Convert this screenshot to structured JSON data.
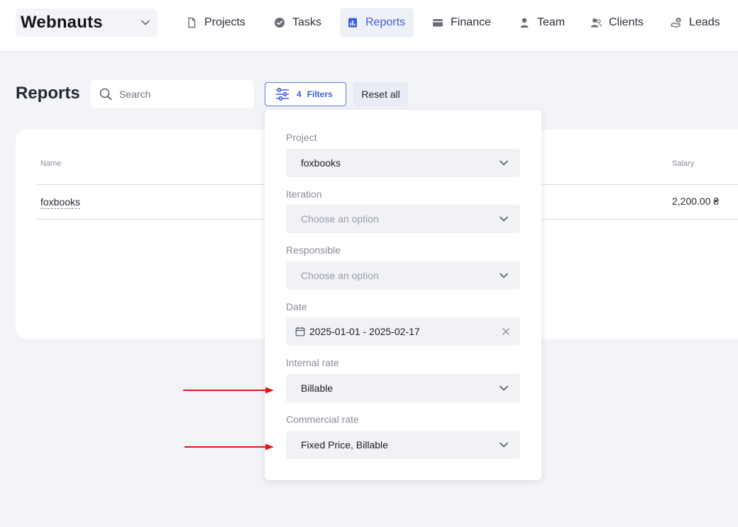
{
  "topbar": {
    "workspace": "Webnauts",
    "nav": [
      {
        "label": "Projects",
        "icon": "file-icon",
        "active": false
      },
      {
        "label": "Tasks",
        "icon": "check-circle-icon",
        "active": false
      },
      {
        "label": "Reports",
        "icon": "report-chart-icon",
        "active": true
      },
      {
        "label": "Finance",
        "icon": "wallet-icon",
        "active": false
      },
      {
        "label": "Team",
        "icon": "person-icon",
        "active": false
      },
      {
        "label": "Clients",
        "icon": "clients-icon",
        "active": false
      },
      {
        "label": "Leads",
        "icon": "leads-icon",
        "active": false
      }
    ]
  },
  "page": {
    "title": "Reports",
    "search_placeholder": "Search",
    "filters_count": "4",
    "filters_label": "Filters",
    "reset_label": "Reset all"
  },
  "table": {
    "columns": [
      "Name",
      "Salary"
    ],
    "rows": [
      {
        "name": "foxbooks",
        "salary": "2,200.00 ₴"
      }
    ]
  },
  "filters": {
    "project": {
      "label": "Project",
      "value": "foxbooks"
    },
    "iteration": {
      "label": "Iteration",
      "placeholder": "Choose an option"
    },
    "responsible": {
      "label": "Responsible",
      "placeholder": "Choose an option"
    },
    "date": {
      "label": "Date",
      "value": "2025-01-01 - 2025-02-17"
    },
    "internal_rate": {
      "label": "Internal rate",
      "value": "Billable"
    },
    "commercial_rate": {
      "label": "Commercial rate",
      "value": "Fixed Price, Billable"
    }
  },
  "colors": {
    "accent": "#3d5fd8",
    "annotation_arrow": "#e8141b",
    "background": "#f3f4f8"
  }
}
